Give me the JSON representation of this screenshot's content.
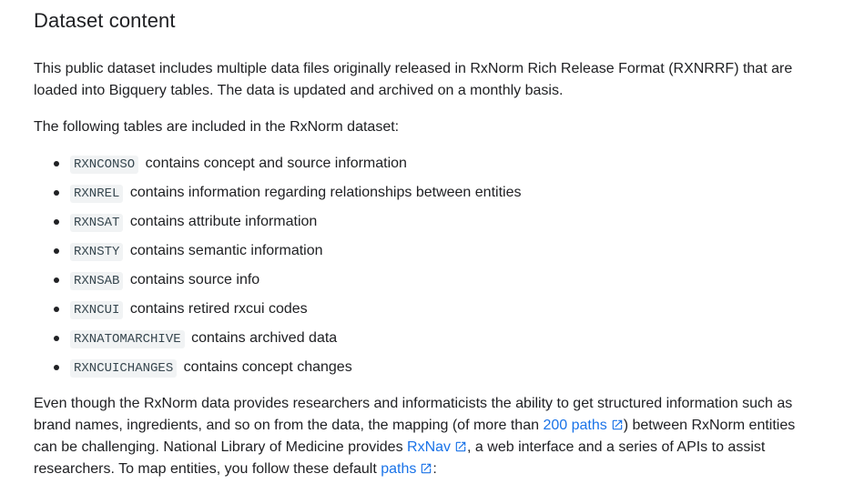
{
  "heading": "Dataset content",
  "intro": "This public dataset includes multiple data files originally released in RxNorm Rich Release Format (RXNRRF) that are loaded into Bigquery tables. The data is updated and archived on a monthly basis.",
  "lead": "The following tables are included in the RxNorm dataset:",
  "tables": [
    {
      "name": "RXNCONSO",
      "desc": "contains concept and source information"
    },
    {
      "name": "RXNREL",
      "desc": "contains information regarding relationships between entities"
    },
    {
      "name": "RXNSAT",
      "desc": "contains attribute information"
    },
    {
      "name": "RXNSTY",
      "desc": "contains semantic information"
    },
    {
      "name": "RXNSAB",
      "desc": "contains source info"
    },
    {
      "name": "RXNCUI",
      "desc": "contains retired rxcui codes"
    },
    {
      "name": "RXNATOMARCHIVE",
      "desc": "contains archived data"
    },
    {
      "name": "RXNCUICHANGES",
      "desc": "contains concept changes"
    }
  ],
  "closing": {
    "part1": "Even though the RxNorm data provides researchers and informaticists the ability to get structured information such as brand names, ingredients, and so on from the data, the mapping (of more than ",
    "link1": "200 paths",
    "part2": ") between RxNorm entities can be challenging. National Library of Medicine provides ",
    "link2": "RxNav",
    "part3": ", a web interface and a series of APIs to assist researchers. To map entities, you follow these default ",
    "link3": "paths",
    "part4": ":"
  },
  "icons": {
    "external": "external-link-icon",
    "bullet": "bullet-dot"
  },
  "colors": {
    "text": "#202124",
    "link": "#1a73e8",
    "code_bg": "#f1f3f4"
  }
}
